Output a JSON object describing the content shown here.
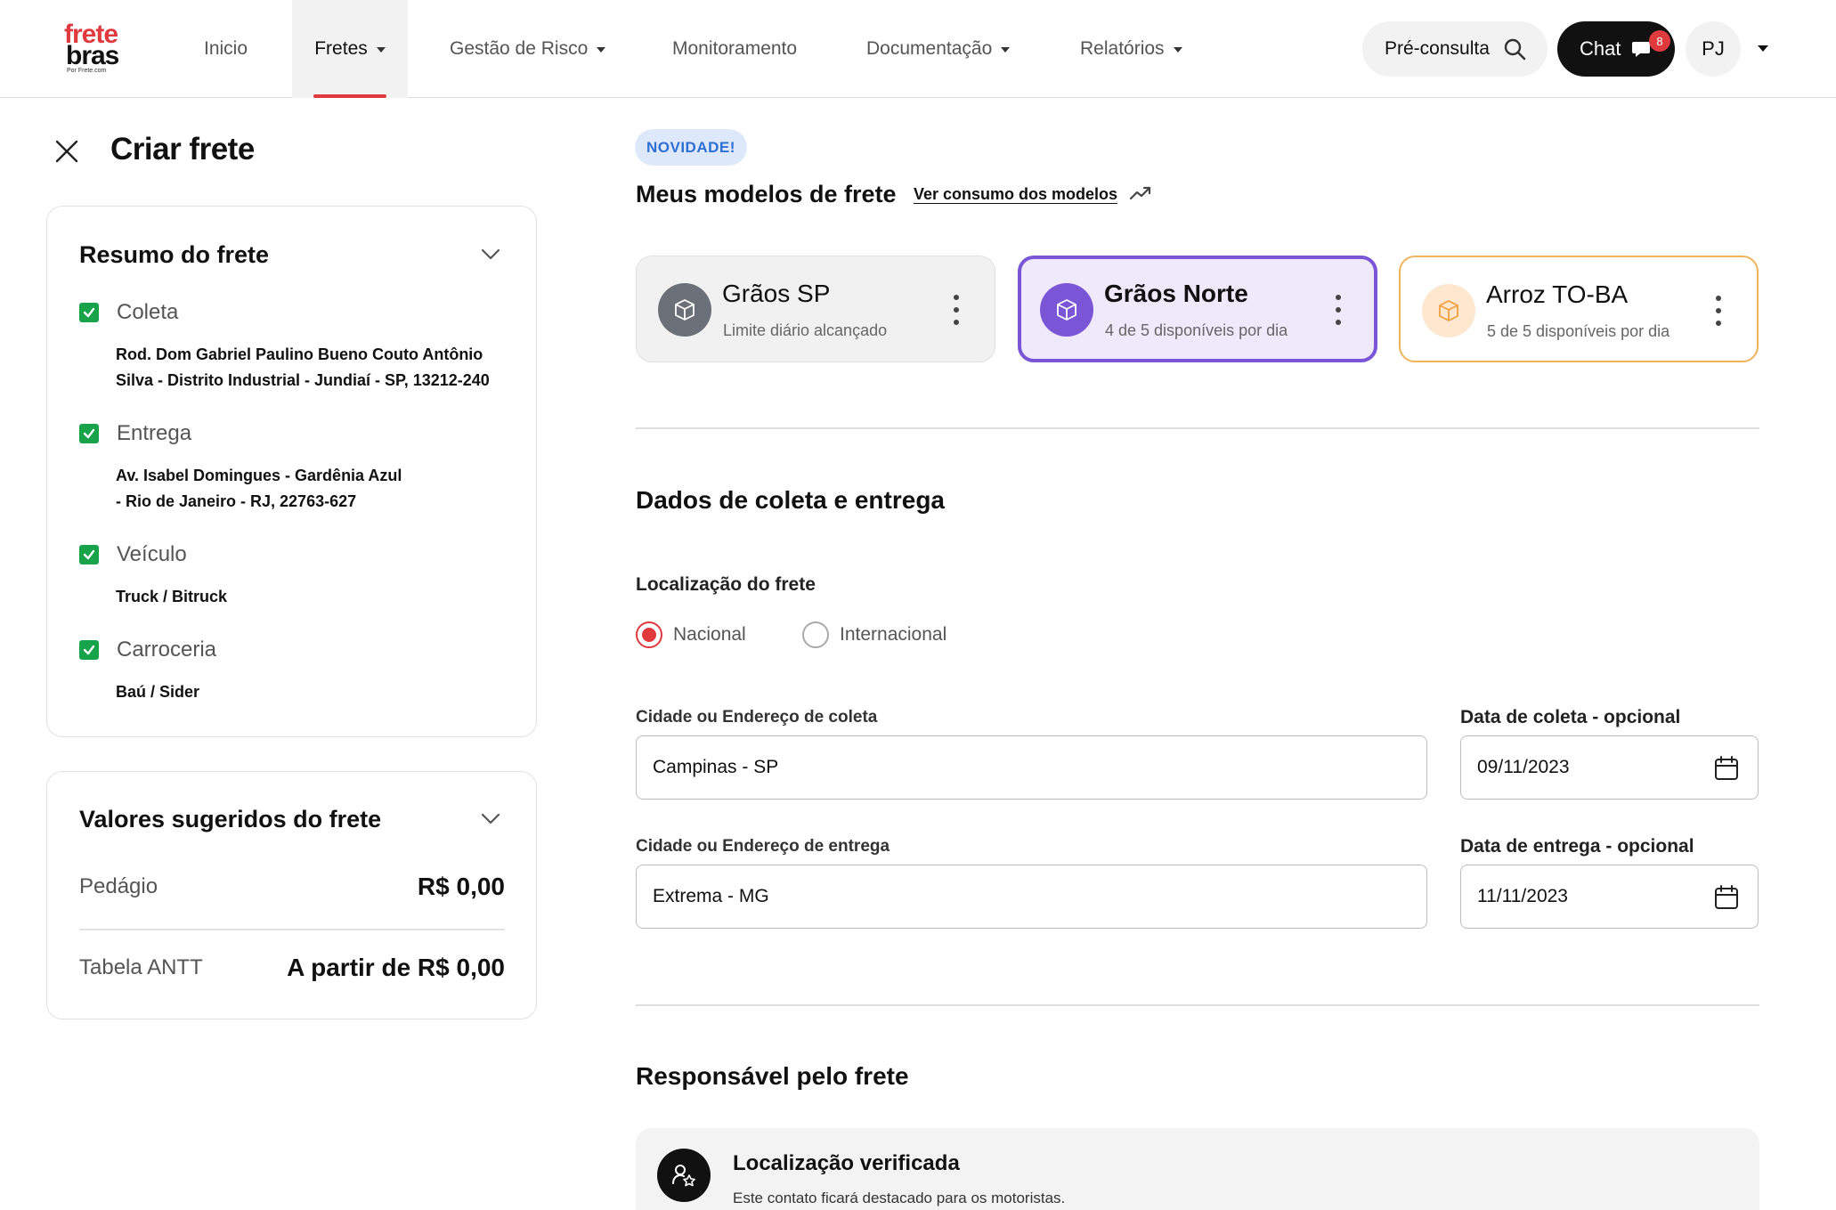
{
  "brand": {
    "line1": "frete",
    "line2": "bras",
    "tagline": "Por Frete.com"
  },
  "nav": {
    "items": [
      {
        "label": "Inicio"
      },
      {
        "label": "Fretes"
      },
      {
        "label": "Gestão de Risco"
      },
      {
        "label": "Monitoramento"
      },
      {
        "label": "Documentação"
      },
      {
        "label": "Relatórios"
      }
    ],
    "active": "Fretes"
  },
  "header": {
    "pre_consulta_label": "Pré-consulta",
    "chat_label": "Chat",
    "chat_badge": "8",
    "user_initials": "PJ"
  },
  "page": {
    "title": "Criar frete"
  },
  "summary": {
    "title": "Resumo do frete",
    "items": [
      {
        "label": "Coleta",
        "detail_lines": [
          "Rod. Dom Gabriel Paulino Bueno Couto Antônio",
          "Silva - Distrito Industrial - Jundiaí - SP, 13212-240"
        ]
      },
      {
        "label": "Entrega",
        "detail_lines": [
          "Av. Isabel Domingues - Gardênia Azul",
          "- Rio de Janeiro - RJ, 22763-627"
        ]
      },
      {
        "label": "Veículo",
        "detail_lines": [
          "Truck / Bitruck"
        ]
      },
      {
        "label": "Carroceria",
        "detail_lines": [
          "Baú / Sider"
        ]
      }
    ]
  },
  "values": {
    "title": "Valores sugeridos do frete",
    "rows": [
      {
        "label": "Pedágio",
        "amount": "R$ 0,00"
      },
      {
        "label": "Tabela ANTT",
        "amount": "A partir de R$ 0,00"
      }
    ]
  },
  "models": {
    "badge": "NOVIDADE!",
    "title": "Meus modelos de frete",
    "link": "Ver consumo dos modelos",
    "cards": [
      {
        "name": "Grãos SP",
        "status": "Limite diário alcançado",
        "state": "disabled"
      },
      {
        "name": "Grãos Norte",
        "status": "4 de 5 disponíveis por dia",
        "state": "selected"
      },
      {
        "name": "Arroz TO-BA",
        "status": "5 de 5 disponíveis por dia",
        "state": "available"
      }
    ]
  },
  "collection": {
    "title": "Dados de coleta e entrega",
    "location_label": "Localização do frete",
    "radio_options": [
      "Nacional",
      "Internacional"
    ],
    "selected_option": "Nacional",
    "pickup_label": "Cidade ou Endereço de coleta",
    "pickup_value": "Campinas - SP",
    "pickup_date_label": "Data de coleta - opcional",
    "pickup_date": "09/11/2023",
    "delivery_label": "Cidade ou Endereço de entrega",
    "delivery_value": "Extrema - MG",
    "delivery_date_label": "Data de entrega - opcional",
    "delivery_date": "11/11/2023"
  },
  "responsible": {
    "title": "Responsável pelo frete",
    "card_title": "Localização verificada",
    "card_subtitle": "Este contato ficará destacado para os motoristas."
  },
  "colors": {
    "accent_red": "#e0393e",
    "selected_purple": "#7a55d6",
    "available_orange": "#f0b25a",
    "check_green": "#17a34a"
  },
  "icons": [
    "close-icon",
    "chevron-down-icon",
    "search-icon",
    "chat-bubble-icon",
    "box-icon",
    "kebab-icon",
    "trend-up-icon",
    "calendar-icon",
    "verified-user-icon"
  ]
}
